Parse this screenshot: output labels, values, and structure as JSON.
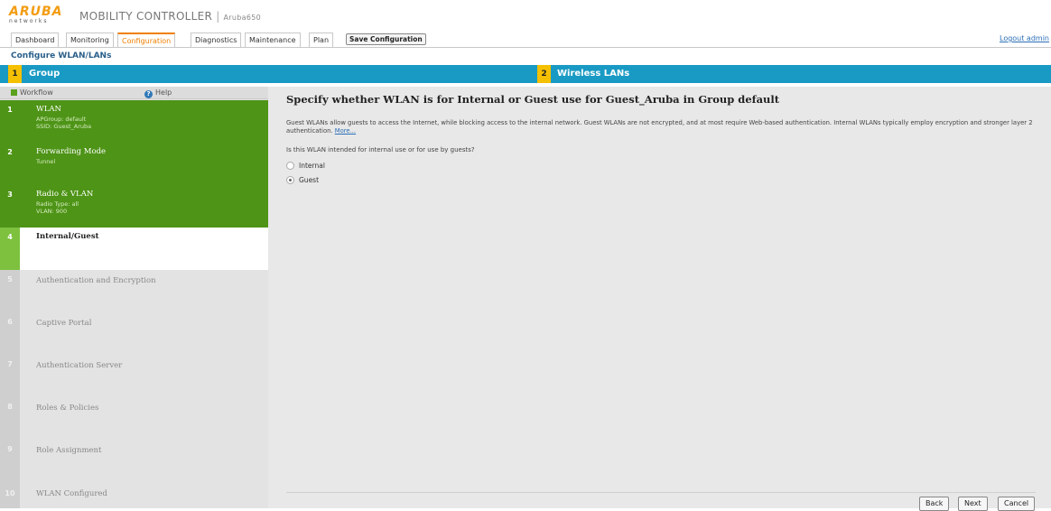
{
  "brand": {
    "logo_text": "ARUBA",
    "logo_sub": "networks",
    "product": "MOBILITY CONTROLLER",
    "separator": "|",
    "device": "Aruba650"
  },
  "nav": {
    "tabs": [
      "Dashboard",
      "Monitoring",
      "Configuration",
      "Diagnostics",
      "Maintenance",
      "Plan"
    ],
    "active_tab": "Configuration",
    "save_label": "Save Configuration",
    "logout_label": "Logout admin"
  },
  "breadcrumb": "Configure WLAN/LANs",
  "steps": [
    {
      "num": "1",
      "label": "Group"
    },
    {
      "num": "2",
      "label": "Wireless LANs"
    }
  ],
  "sidebar": {
    "workflow_label": "Workflow",
    "help_label": "Help",
    "items": [
      {
        "num": "1",
        "title": "WLAN",
        "sub": [
          "APGroup: default",
          "SSID: Guest_Aruba"
        ],
        "state": "done"
      },
      {
        "num": "2",
        "title": "Forwarding Mode",
        "sub": [
          "Tunnel"
        ],
        "state": "done"
      },
      {
        "num": "3",
        "title": "Radio & VLAN",
        "sub": [
          "Radio Type: all",
          "VLAN: 900"
        ],
        "state": "done"
      },
      {
        "num": "4",
        "title": "Internal/Guest",
        "sub": [],
        "state": "current"
      },
      {
        "num": "5",
        "title": "Authentication and Encryption",
        "sub": [],
        "state": "todo"
      },
      {
        "num": "6",
        "title": "Captive Portal",
        "sub": [],
        "state": "todo"
      },
      {
        "num": "7",
        "title": "Authentication Server",
        "sub": [],
        "state": "todo"
      },
      {
        "num": "8",
        "title": "Roles & Policies",
        "sub": [],
        "state": "todo"
      },
      {
        "num": "9",
        "title": "Role Assignment",
        "sub": [],
        "state": "todo"
      },
      {
        "num": "10",
        "title": "WLAN Configured",
        "sub": [],
        "state": "todo"
      }
    ]
  },
  "main": {
    "title": "Specify whether WLAN is for Internal or Guest use for Guest_Aruba in Group default",
    "description": "Guest WLANs allow guests to access the Internet, while blocking access to the internal network. Guest WLANs are not encrypted, and at most require Web-based authentication. Internal WLANs typically employ encryption and stronger layer 2 authentication.",
    "more_link": "More...",
    "question": "Is this WLAN intended for internal use or for use by guests?",
    "options": [
      {
        "label": "Internal",
        "selected": false
      },
      {
        "label": "Guest",
        "selected": true
      }
    ],
    "buttons": {
      "back": "Back",
      "next": "Next",
      "cancel": "Cancel"
    }
  },
  "colors": {
    "accent_orange": "#f08000",
    "step_blue": "#199ac4",
    "step_yellow": "#f5c000",
    "done_green": "#4e9417",
    "current_green": "#7dc13f",
    "link_blue": "#2a6fb7"
  }
}
